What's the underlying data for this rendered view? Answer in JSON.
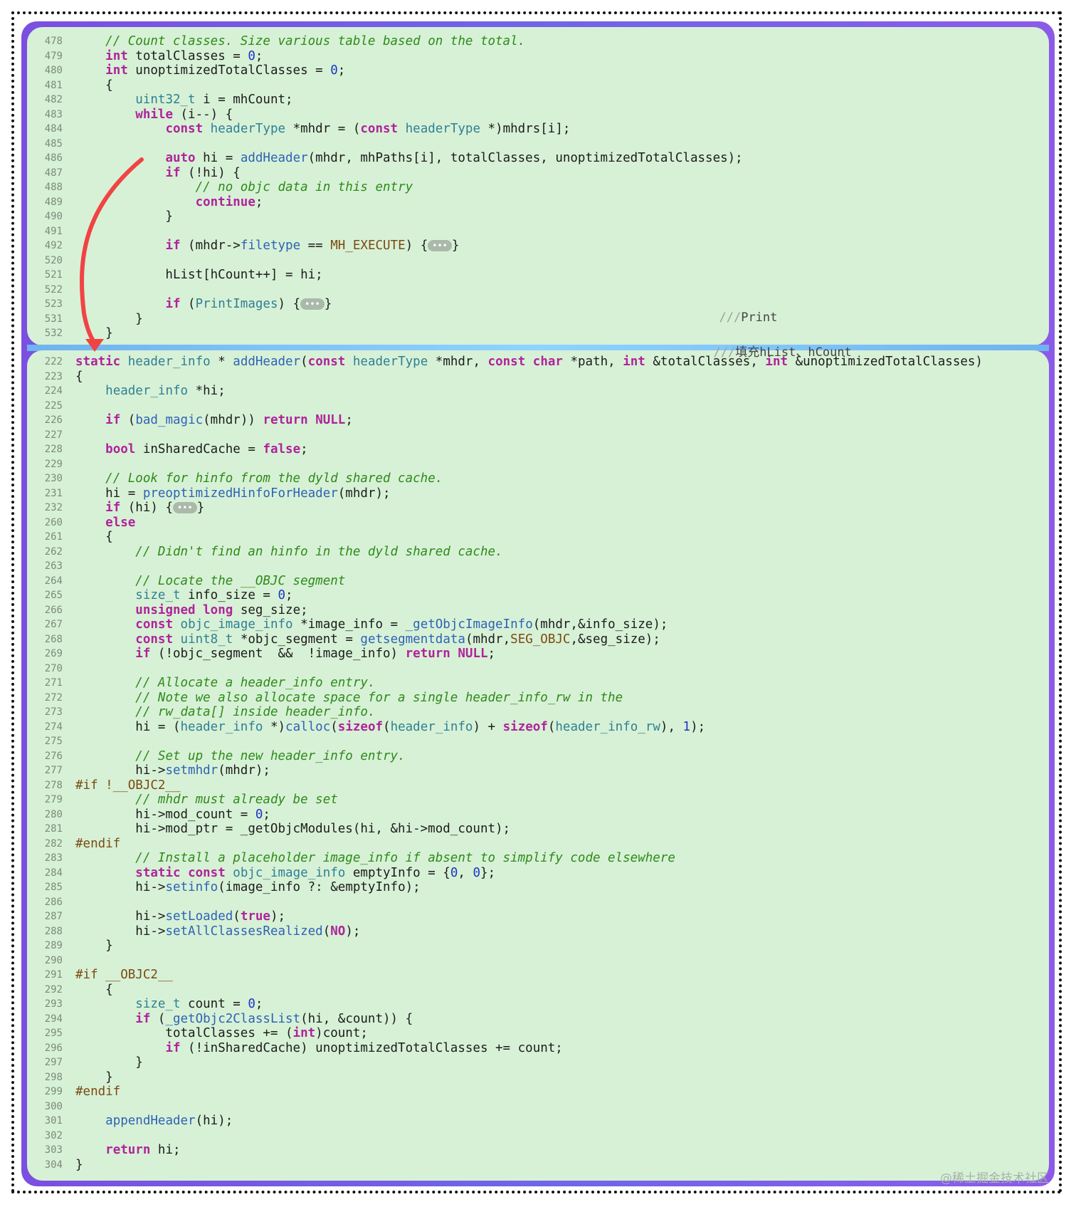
{
  "top_lines": [
    {
      "n": "478",
      "h": "    <span class='c'>// Count classes. Size various table based on the total.</span>"
    },
    {
      "n": "479",
      "h": "    <span class='k'>int</span> totalClasses = <span class='n'>0</span>;"
    },
    {
      "n": "480",
      "h": "    <span class='k'>int</span> unoptimizedTotalClasses = <span class='n'>0</span>;"
    },
    {
      "n": "481",
      "h": "    {"
    },
    {
      "n": "482",
      "h": "        <span class='t'>uint32_t</span> i = mhCount;"
    },
    {
      "n": "483",
      "h": "        <span class='k'>while</span> (i--) {"
    },
    {
      "n": "484",
      "h": "            <span class='k'>const</span> <span class='t'>headerType</span> *mhdr = (<span class='k'>const</span> <span class='t'>headerType</span> *)mhdrs[i];"
    },
    {
      "n": "485",
      "h": ""
    },
    {
      "n": "486",
      "h": "            <span class='k'>auto</span> hi = <span class='f'>addHeader</span>(mhdr, mhPaths[i], totalClasses, unoptimizedTotalClasses);"
    },
    {
      "n": "487",
      "h": "            <span class='k'>if</span> (!hi) {"
    },
    {
      "n": "488",
      "h": "                <span class='c'>// no objc data in this entry</span>"
    },
    {
      "n": "489",
      "h": "                <span class='k'>continue</span>;"
    },
    {
      "n": "490",
      "h": "            }"
    },
    {
      "n": "491",
      "h": ""
    },
    {
      "n": "492",
      "h": "            <span class='k'>if</span> (mhdr-><span class='f'>filetype</span> == <span class='m'>MH_EXECUTE</span>) {<span class='fold'>•••</span>}"
    },
    {
      "n": "520",
      "h": ""
    },
    {
      "n": "521",
      "h": "            hList[hCount++] = hi;"
    },
    {
      "n": "522",
      "h": ""
    },
    {
      "n": "523",
      "h": "            <span class='k'>if</span> (<span class='t'>PrintImages</span>) {<span class='fold'>•••</span>}"
    },
    {
      "n": "531",
      "h": "        }"
    },
    {
      "n": "532",
      "h": "    }"
    }
  ],
  "hints": {
    "print": "Print",
    "fill": "填充hList、hCount",
    "slashes": "///"
  },
  "bottom_lines": [
    {
      "n": "222",
      "h": "<span class='k'>static</span> <span class='t'>header_info</span> * <span class='f'>addHeader</span>(<span class='k'>const</span> <span class='t'>headerType</span> *mhdr, <span class='k'>const</span> <span class='k'>char</span> *path, <span class='k'>int</span> &amp;totalClasses, <span class='k'>int</span> &amp;unoptimizedTotalClasses)"
    },
    {
      "n": "223",
      "h": "{"
    },
    {
      "n": "224",
      "h": "    <span class='t'>header_info</span> *hi;"
    },
    {
      "n": "225",
      "h": ""
    },
    {
      "n": "226",
      "h": "    <span class='k'>if</span> (<span class='f'>bad_magic</span>(mhdr)) <span class='k'>return</span> <span class='k'>NULL</span>;"
    },
    {
      "n": "227",
      "h": ""
    },
    {
      "n": "228",
      "h": "    <span class='k'>bool</span> inSharedCache = <span class='k'>false</span>;"
    },
    {
      "n": "229",
      "h": ""
    },
    {
      "n": "230",
      "h": "    <span class='c'>// Look for hinfo from the dyld shared cache.</span>"
    },
    {
      "n": "231",
      "h": "    hi = <span class='f'>preoptimizedHinfoForHeader</span>(mhdr);"
    },
    {
      "n": "232",
      "h": "    <span class='k'>if</span> (hi) {<span class='fold'>•••</span>}"
    },
    {
      "n": "260",
      "h": "    <span class='k'>else</span>"
    },
    {
      "n": "261",
      "h": "    {"
    },
    {
      "n": "262",
      "h": "        <span class='c'>// Didn't find an hinfo in the dyld shared cache.</span>"
    },
    {
      "n": "263",
      "h": ""
    },
    {
      "n": "264",
      "h": "        <span class='c'>// Locate the __OBJC segment</span>"
    },
    {
      "n": "265",
      "h": "        <span class='t'>size_t</span> info_size = <span class='n'>0</span>;"
    },
    {
      "n": "266",
      "h": "        <span class='k'>unsigned</span> <span class='k'>long</span> seg_size;"
    },
    {
      "n": "267",
      "h": "        <span class='k'>const</span> <span class='t'>objc_image_info</span> *image_info = <span class='f'>_getObjcImageInfo</span>(mhdr,&amp;info_size);"
    },
    {
      "n": "268",
      "h": "        <span class='k'>const</span> <span class='t'>uint8_t</span> *objc_segment = <span class='f'>getsegmentdata</span>(mhdr,<span class='m'>SEG_OBJC</span>,&amp;seg_size);"
    },
    {
      "n": "269",
      "h": "        <span class='k'>if</span> (!objc_segment  &amp;&amp;  !image_info) <span class='k'>return</span> <span class='k'>NULL</span>;"
    },
    {
      "n": "270",
      "h": ""
    },
    {
      "n": "271",
      "h": "        <span class='c'>// Allocate a header_info entry.</span>"
    },
    {
      "n": "272",
      "h": "        <span class='c'>// Note we also allocate space for a single header_info_rw in the</span>"
    },
    {
      "n": "273",
      "h": "        <span class='c'>// rw_data[] inside header_info.</span>"
    },
    {
      "n": "274",
      "h": "        hi = (<span class='t'>header_info</span> *)<span class='f'>calloc</span>(<span class='k'>sizeof</span>(<span class='t'>header_info</span>) + <span class='k'>sizeof</span>(<span class='t'>header_info_rw</span>), <span class='n'>1</span>);"
    },
    {
      "n": "275",
      "h": ""
    },
    {
      "n": "276",
      "h": "        <span class='c'>// Set up the new header_info entry.</span>"
    },
    {
      "n": "277",
      "h": "        hi-><span class='f'>setmhdr</span>(mhdr);"
    },
    {
      "n": "278",
      "h": "<span class='m'>#if !__OBJC2__</span>"
    },
    {
      "n": "279",
      "h": "        <span class='c'>// mhdr must already be set</span>"
    },
    {
      "n": "280",
      "h": "        hi->mod_count = <span class='n'>0</span>;"
    },
    {
      "n": "281",
      "h": "        hi->mod_ptr = _getObjcModules(hi, &amp;hi->mod_count);"
    },
    {
      "n": "282",
      "h": "<span class='m'>#endif</span>"
    },
    {
      "n": "283",
      "h": "        <span class='c'>// Install a placeholder image_info if absent to simplify code elsewhere</span>"
    },
    {
      "n": "284",
      "h": "        <span class='k'>static</span> <span class='k'>const</span> <span class='t'>objc_image_info</span> emptyInfo = {<span class='n'>0</span>, <span class='n'>0</span>};"
    },
    {
      "n": "285",
      "h": "        hi-><span class='f'>setinfo</span>(image_info ?: &amp;emptyInfo);"
    },
    {
      "n": "286",
      "h": ""
    },
    {
      "n": "287",
      "h": "        hi-><span class='f'>setLoaded</span>(<span class='k'>true</span>);"
    },
    {
      "n": "288",
      "h": "        hi-><span class='f'>setAllClassesRealized</span>(<span class='k'>NO</span>);"
    },
    {
      "n": "289",
      "h": "    }"
    },
    {
      "n": "290",
      "h": ""
    },
    {
      "n": "291",
      "h": "<span class='m'>#if __OBJC2__</span>"
    },
    {
      "n": "292",
      "h": "    {"
    },
    {
      "n": "293",
      "h": "        <span class='t'>size_t</span> count = <span class='n'>0</span>;"
    },
    {
      "n": "294",
      "h": "        <span class='k'>if</span> (<span class='f'>_getObjc2ClassList</span>(hi, &amp;count)) {"
    },
    {
      "n": "295",
      "h": "            totalClasses += (<span class='k'>int</span>)count;"
    },
    {
      "n": "296",
      "h": "            <span class='k'>if</span> (!inSharedCache) unoptimizedTotalClasses += count;"
    },
    {
      "n": "297",
      "h": "        }"
    },
    {
      "n": "298",
      "h": "    }"
    },
    {
      "n": "299",
      "h": "<span class='m'>#endif</span>"
    },
    {
      "n": "300",
      "h": ""
    },
    {
      "n": "301",
      "h": "    <span class='f'>appendHeader</span>(hi);"
    },
    {
      "n": "302",
      "h": ""
    },
    {
      "n": "303",
      "h": "    <span class='k'>return</span> hi;"
    },
    {
      "n": "304",
      "h": "}"
    }
  ],
  "watermark": "@稀土掘金技术社区",
  "colors": {
    "keyword": "#b0239b",
    "type": "#2f7f94",
    "function": "#2e62b5",
    "comment": "#2e8a1a",
    "number": "#1c35c5",
    "macro": "#7b4a12",
    "panel": "#d7f1d6",
    "arrow": "#f04444"
  }
}
